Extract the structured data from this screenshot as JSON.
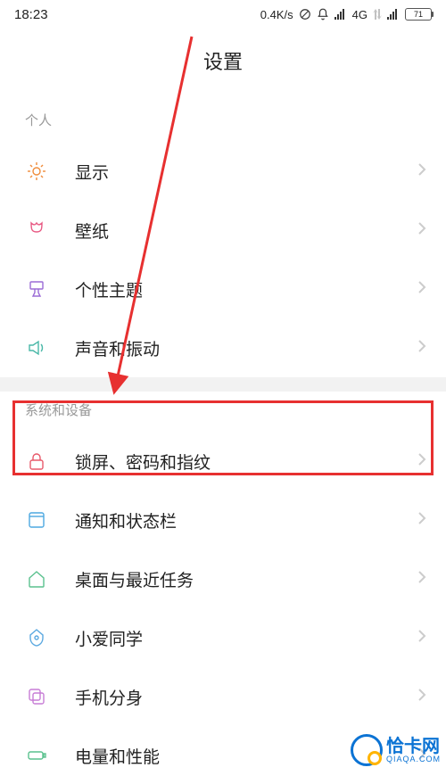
{
  "statusbar": {
    "time": "18:23",
    "speed": "0.4K/s",
    "network": "4G",
    "battery": "71"
  },
  "header": {
    "title": "设置"
  },
  "sections": {
    "personal": {
      "label": "个人",
      "items": [
        {
          "label": "显示"
        },
        {
          "label": "壁纸"
        },
        {
          "label": "个性主题"
        },
        {
          "label": "声音和振动"
        }
      ]
    },
    "system": {
      "label": "系统和设备",
      "items": [
        {
          "label": "锁屏、密码和指纹"
        },
        {
          "label": "通知和状态栏"
        },
        {
          "label": "桌面与最近任务"
        },
        {
          "label": "小爱同学"
        },
        {
          "label": "手机分身"
        },
        {
          "label": "电量和性能"
        }
      ]
    }
  },
  "watermark": {
    "name": "恰卡网",
    "url": "QIAQA.COM"
  }
}
